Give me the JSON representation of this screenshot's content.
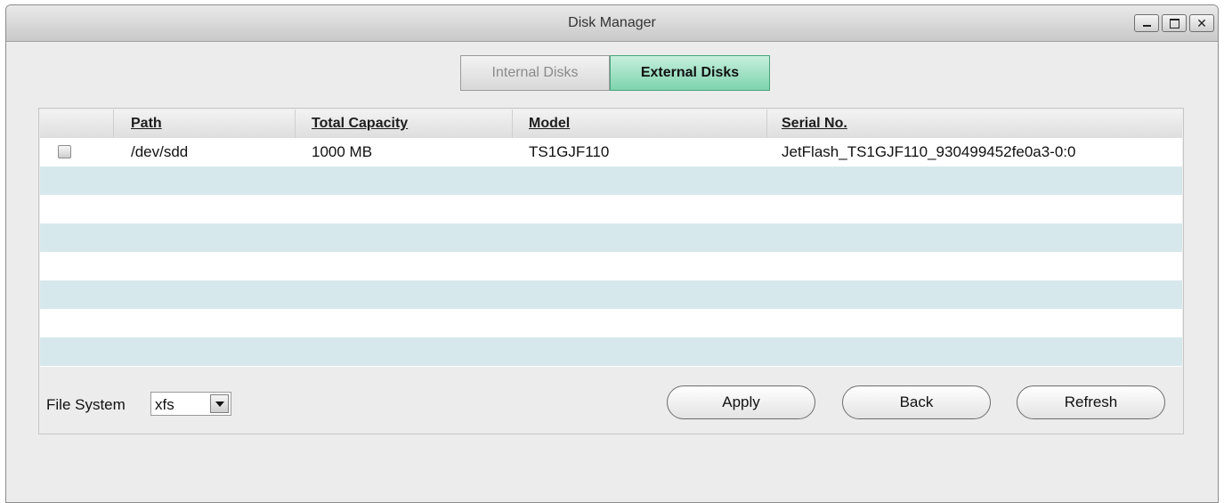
{
  "window": {
    "title": "Disk Manager",
    "controls": [
      "minimize",
      "maximize",
      "close"
    ],
    "close_glyph": "✕"
  },
  "tabs": [
    {
      "label": "Internal Disks",
      "active": false
    },
    {
      "label": "External Disks",
      "active": true
    }
  ],
  "table": {
    "columns": [
      "Path",
      "Total Capacity",
      "Model",
      "Serial No."
    ],
    "rows": [
      {
        "checked": false,
        "path": "/dev/sdd",
        "capacity": "1000 MB",
        "model": "TS1GJF110",
        "serial": "JetFlash_TS1GJF110_930499452fe0a3-0:0"
      }
    ],
    "row_colors": {
      "even": "#ffffff",
      "odd": "#d7e8ec"
    }
  },
  "file_system": {
    "label": "File System",
    "value": "xfs"
  },
  "buttons": {
    "apply": "Apply",
    "back": "Back",
    "refresh": "Refresh"
  },
  "colors": {
    "active_tab": "#7ed3ae",
    "window_bg": "#ececec"
  }
}
